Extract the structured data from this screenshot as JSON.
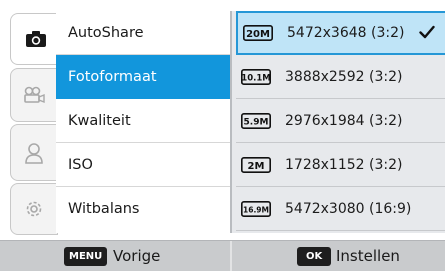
{
  "tabs": [
    {
      "icon": "camera-icon",
      "active": true
    },
    {
      "icon": "video-camera-icon",
      "active": false
    },
    {
      "icon": "user-icon",
      "active": false
    },
    {
      "icon": "gear-icon",
      "active": false
    }
  ],
  "menu": {
    "items": [
      {
        "label": "AutoShare"
      },
      {
        "label": "Fotoformaat"
      },
      {
        "label": "Kwaliteit"
      },
      {
        "label": "ISO"
      },
      {
        "label": "Witbalans"
      }
    ],
    "selected": "Fotoformaat"
  },
  "options": {
    "items": [
      {
        "badge": "20M",
        "label": "5472x3648 (3:2)"
      },
      {
        "badge": "10.1M",
        "label": "3888x2592 (3:2)"
      },
      {
        "badge": "5.9M",
        "label": "2976x1984 (3:2)"
      },
      {
        "badge": "2M",
        "label": "1728x1152 (3:2)"
      },
      {
        "badge": "16.9M",
        "label": "5472x3080 (16:9)"
      }
    ],
    "selected": "5472x3648 (3:2)"
  },
  "footer": {
    "menu_key": "MENU",
    "menu_label": "Vorige",
    "ok_key": "OK",
    "ok_label": "Instellen"
  },
  "colors": {
    "selection_blue": "#1296dc",
    "panel_bg": "#e7e9ec",
    "selected_option_bg": "#bfe4f7",
    "bottom_bar": "#c9cbcd"
  }
}
